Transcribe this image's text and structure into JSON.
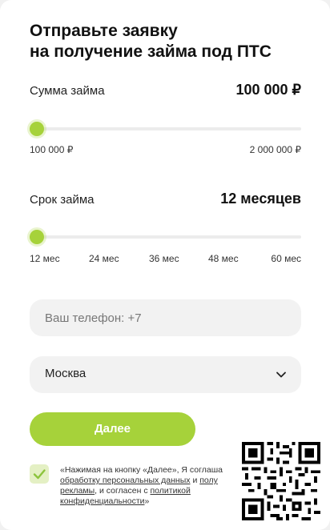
{
  "form": {
    "title_line1": "Отправьте заявку",
    "title_line2": "на получение займа под ПТС"
  },
  "amount": {
    "label": "Сумма займа",
    "value": "100 000 ₽",
    "min_label": "100 000 ₽",
    "max_label": "2 000 000 ₽",
    "slider_fraction": 0.0
  },
  "term": {
    "label": "Срок займа",
    "value": "12 месяцев",
    "ticks": [
      "12 мес",
      "24 мес",
      "36 мес",
      "48 мес",
      "60 мес"
    ],
    "slider_fraction": 0.0
  },
  "phone": {
    "placeholder": "Ваш телефон: +7"
  },
  "city": {
    "selected": "Москва"
  },
  "submit": {
    "label": "Далее"
  },
  "consent": {
    "text_start": "«Нажимая на кнопку «Далее», Я соглаша",
    "link1": "обработку персональных данных",
    "text_and": " и ",
    "link2": "полу",
    "link2b": "рекламы",
    "text_mid": ", и согласен с ",
    "link3": "политикой конфиденциальности",
    "text_end": "»"
  },
  "colors": {
    "accent": "#a6d23a",
    "field_bg": "#f2f2f2"
  },
  "icons": {
    "checkbox": "check-icon",
    "select": "chevron-down-icon",
    "qr": "qr-code"
  }
}
